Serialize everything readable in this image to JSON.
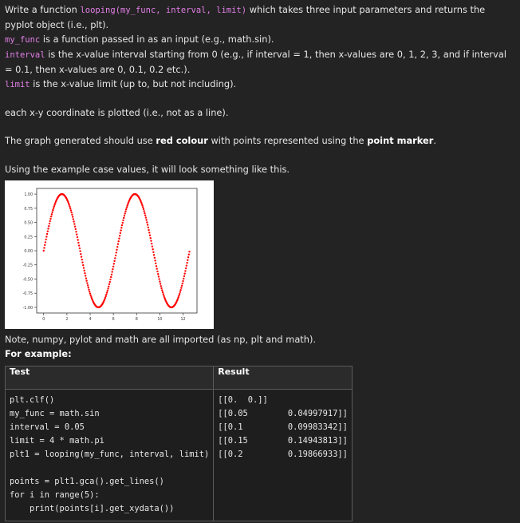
{
  "intro": {
    "line1_pre": "Write a function ",
    "fn_sig": "looping(my_func, interval, limit)",
    "line1_post": " which takes three input parameters and returns the pyplot object (i.e., plt).",
    "my_func_code": "my_func",
    "my_func_desc": " is a function passed in as an input (e.g., math.sin).",
    "interval_code": "interval",
    "interval_desc": " is the x-value interval starting from 0 (e.g., if interval = 1, then x-values are 0, 1, 2, 3, and if interval = 0.1, then x-values are 0, 0.1, 0.2 etc.).",
    "limit_code": "limit",
    "limit_desc": " is the x-value limit (up to, but not including)."
  },
  "note_plotted": "each x-y coordinate is plotted (i.e., not as a line).",
  "graph_desc": {
    "pre": "The graph generated should use ",
    "red": "red colour",
    "mid": " with points represented using the ",
    "marker": "point marker",
    "post": "."
  },
  "example_case": "Using the example case values, it will look something like this.",
  "chart_data": {
    "type": "scatter",
    "function": "sin",
    "x_start": 0,
    "x_step": 0.05,
    "x_limit": 12.566370614359172,
    "color": "#ff0000",
    "marker": "point",
    "xlim": [
      -0.6,
      13.2
    ],
    "ylim": [
      -1.1,
      1.1
    ],
    "xticks": [
      "0",
      "2",
      "4",
      "6",
      "8",
      "10",
      "12"
    ],
    "xtick_values": [
      0,
      2,
      4,
      6,
      8,
      10,
      12
    ],
    "yticks": [
      "1.00",
      "0.75",
      "0.50",
      "0.25",
      "0.00",
      "-0.25",
      "-0.50",
      "-0.75",
      "-1.00"
    ],
    "ytick_values": [
      1.0,
      0.75,
      0.5,
      0.25,
      0.0,
      -0.25,
      -0.5,
      -0.75,
      -1.0
    ],
    "grid": false
  },
  "note_imports": "Note, numpy, pylot and math are all imported (as np, plt and math).",
  "for_example": "For example:",
  "table": {
    "headers": [
      "Test",
      "Result"
    ],
    "test_code": "plt.clf()\nmy_func = math.sin\ninterval = 0.05\nlimit = 4 * math.pi\nplt1 = looping(my_func, interval, limit)\n\npoints = plt1.gca().get_lines()\nfor i in range(5):\n    print(points[i].get_xydata())",
    "result_code": "[[0.  0.]]\n[[0.05        0.04997917]]\n[[0.1         0.09983342]]\n[[0.15        0.14943813]]\n[[0.2         0.19866933]]"
  }
}
